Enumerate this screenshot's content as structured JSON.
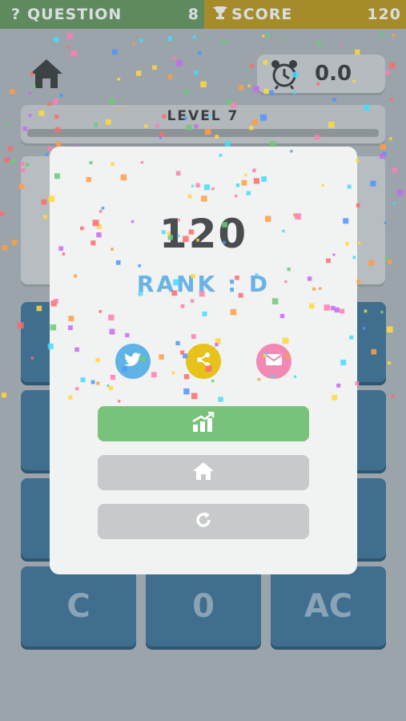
{
  "header": {
    "question_icon": "?",
    "question_label": "QUESTION",
    "question_value": "8",
    "score_icon": "trophy-icon",
    "score_label": "SCORE",
    "score_value": "120"
  },
  "timer": {
    "value": "0.0"
  },
  "level": {
    "label": "LEVEL 7"
  },
  "keypad": {
    "clear": "C",
    "zero": "0",
    "all_clear": "AC"
  },
  "result": {
    "score": "120",
    "rank": "RANK : D"
  },
  "share": [
    {
      "name": "twitter",
      "color": "#5fb3e6"
    },
    {
      "name": "share",
      "color": "#e6c21a"
    },
    {
      "name": "email",
      "color": "#f189b4"
    }
  ],
  "actions": [
    {
      "name": "stats",
      "icon": "chart-up-icon",
      "color": "#79c27c"
    },
    {
      "name": "home",
      "icon": "home-icon",
      "color": "#c8c9ca"
    },
    {
      "name": "retry",
      "icon": "refresh-icon",
      "color": "#c8c9ca"
    }
  ],
  "colors": {
    "overlay_bg": "#9aa4aa",
    "key_blue": "#3f6e8f",
    "rank_blue": "#69b3e6",
    "modal_bg": "#f1f2f2"
  }
}
